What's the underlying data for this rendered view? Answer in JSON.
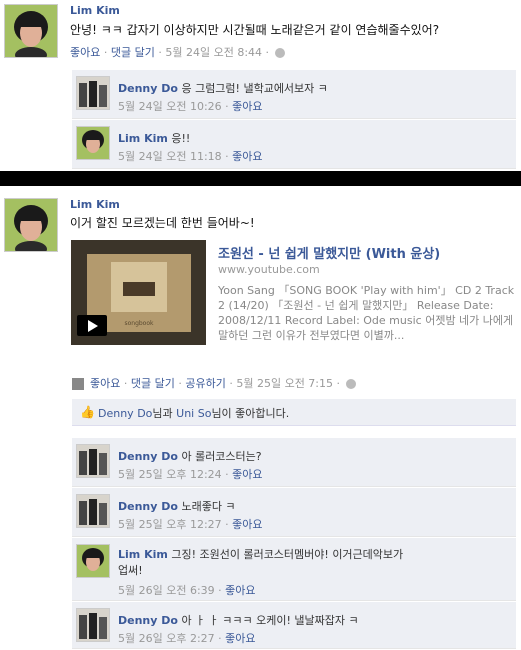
{
  "post1": {
    "author": "Lim Kim",
    "message": "안녕! ㅋㅋ 갑자기 이상하지만 시간될때 노래같은거 같이 연습해줄수있어?",
    "like_label": "좋아요",
    "comment_label": "댓글 달기",
    "timestamp": "5월 24일 오전 8:44",
    "comments": [
      {
        "author": "Denny Do",
        "text": "응 그럼그럼! 낼학교에서보자 ㅋ",
        "time": "5월 24일 오전 10:26",
        "like": "좋아요"
      },
      {
        "author": "Lim Kim",
        "text": "응!!",
        "time": "5월 24일 오전 11:18",
        "like": "좋아요"
      }
    ]
  },
  "post2": {
    "author": "Lim Kim",
    "message": "이거 할진 모르겠는데 한번 들어바~!",
    "video": {
      "title": "조원선 - 넌 쉽게 말했지만 (With 윤상)",
      "url": "www.youtube.com",
      "description": "Yoon Sang 「SONG BOOK 'Play with him'」 CD 2 Track 2 (14/20) 「조원선 - 넌 쉽게 말했지만」 Release Date: 2008/12/11 Record Label: Ode music 어젯밤 네가 나에게 말하던 그런 이유가 전부였다면 이별까..."
    },
    "like_label": "좋아요",
    "comment_label": "댓글 달기",
    "share_label": "공유하기",
    "timestamp": "5월 25일 오전 7:15",
    "likes": {
      "user1": "Denny Do",
      "mid": "님과 ",
      "user2": "Uni So",
      "end": "님이 좋아합니다."
    },
    "comments": [
      {
        "author": "Denny Do",
        "text": "아 롤러코스터는?",
        "time": "5월 25일 오후 12:24",
        "like": "좋아요"
      },
      {
        "author": "Denny Do",
        "text": "노래좋다 ㅋ",
        "time": "5월 25일 오후 12:27",
        "like": "좋아요"
      },
      {
        "author": "Lim Kim",
        "text": "그징! 조원선이 롤러코스터멤버야! 이거근데악보가",
        "text2": "업써!",
        "time": "5월 26일 오전 6:39",
        "like": "좋아요"
      },
      {
        "author": "Denny Do",
        "text": "아 ㅏ ㅏ ㅋㅋㅋ 오케이! 낼날짜잡자 ㅋ",
        "time": "5월 26일 오후 2:27",
        "like": "좋아요"
      }
    ]
  },
  "colors": {
    "link": "#3b5998",
    "comment_bg": "#edeff4",
    "divider": "#000000"
  }
}
